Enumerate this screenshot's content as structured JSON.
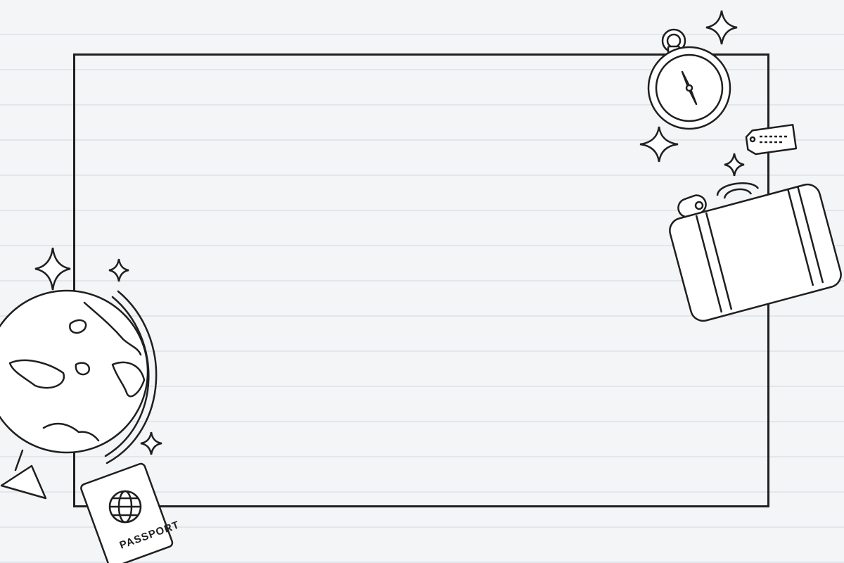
{
  "passport": {
    "label": "PASSPORT"
  },
  "icons": [
    "globe-icon",
    "passport-icon",
    "compass-icon",
    "luggage-tag-icon",
    "suitcase-icon",
    "sparkle-icon"
  ],
  "colors": {
    "background": "#f4f5f7",
    "rule_lines": "#e3e6ea",
    "ink": "#1f1f1f",
    "fill": "#ffffff"
  }
}
